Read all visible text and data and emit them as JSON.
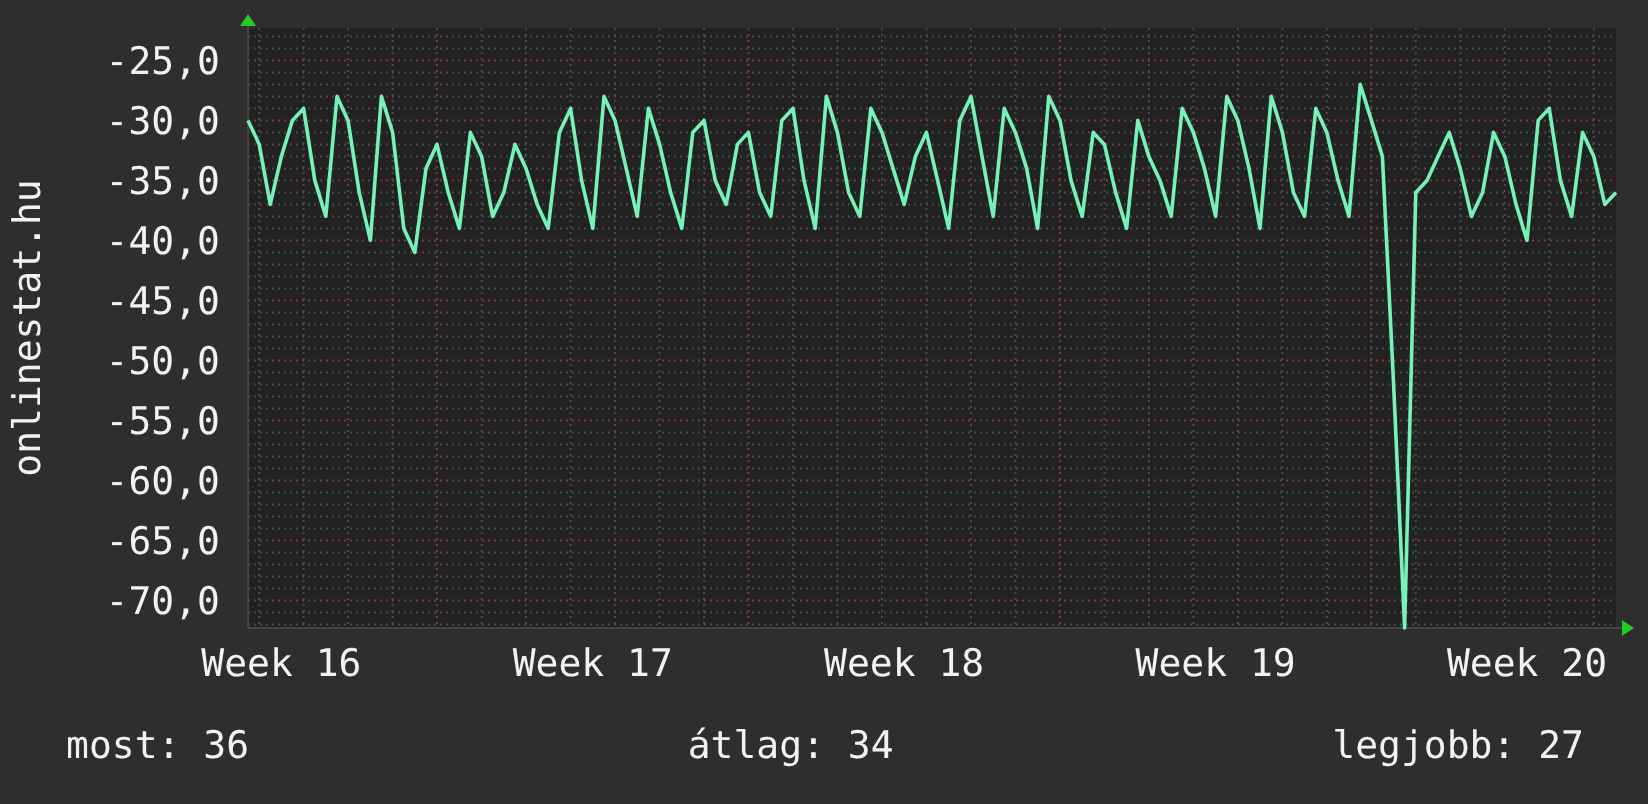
{
  "chart": {
    "chart_data": {
      "type": "line",
      "ylabel": "onlinestat.hu",
      "grid": true,
      "ylim": [
        -72.3,
        -22.3
      ],
      "categories": [
        null,
        null,
        null,
        "Week 16",
        null,
        null,
        null,
        null,
        null,
        null,
        null,
        null,
        null,
        null,
        null,
        null,
        null,
        null,
        null,
        null,
        null,
        null,
        null,
        null,
        null,
        null,
        null,
        null,
        null,
        null,
        null,
        "Week 17",
        null,
        null,
        null,
        null,
        null,
        null,
        null,
        null,
        null,
        null,
        null,
        null,
        null,
        null,
        null,
        null,
        null,
        null,
        null,
        null,
        null,
        null,
        null,
        null,
        null,
        null,
        null,
        "Week 18",
        null,
        null,
        null,
        null,
        null,
        null,
        null,
        null,
        null,
        null,
        null,
        null,
        null,
        null,
        null,
        null,
        null,
        null,
        null,
        null,
        null,
        null,
        null,
        null,
        null,
        null,
        null,
        "Week 19",
        null,
        null,
        null,
        null,
        null,
        null,
        null,
        null,
        null,
        null,
        null,
        null,
        null,
        null,
        null,
        null,
        null,
        null,
        null,
        null,
        null,
        null,
        null,
        null,
        null,
        null,
        null,
        "Week 20",
        null,
        null,
        null,
        null,
        null,
        null,
        null,
        null
      ],
      "yticks": [
        {
          "value": -25,
          "label": "-25,0"
        },
        {
          "value": -30,
          "label": "-30,0"
        },
        {
          "value": -35,
          "label": "-35,0"
        },
        {
          "value": -40,
          "label": "-40,0"
        },
        {
          "value": -45,
          "label": "-45,0"
        },
        {
          "value": -50,
          "label": "-50,0"
        },
        {
          "value": -55,
          "label": "-55,0"
        },
        {
          "value": -60,
          "label": "-60,0"
        },
        {
          "value": -65,
          "label": "-65,0"
        },
        {
          "value": -70,
          "label": "-70,0"
        }
      ],
      "series": [
        {
          "color": "#77f2b6",
          "values": [
            -30,
            -32,
            -37,
            -33,
            -30,
            -29,
            -35,
            -38,
            -28,
            -30,
            -36,
            -40,
            -28,
            -31,
            -39,
            -41,
            -34,
            -32,
            -36,
            -39,
            -31,
            -33,
            -38,
            -36,
            -32,
            -34,
            -37,
            -39,
            -31,
            -29,
            -35,
            -39,
            -28,
            -30,
            -34,
            -38,
            -29,
            -32,
            -36,
            -39,
            -31,
            -30,
            -35,
            -37,
            -32,
            -31,
            -36,
            -38,
            -30,
            -29,
            -35,
            -39,
            -28,
            -31,
            -36,
            -38,
            -29,
            -31,
            -34,
            -37,
            -33,
            -31,
            -35,
            -39,
            -30,
            -28,
            -33,
            -38,
            -29,
            -31,
            -34,
            -39,
            -28,
            -30,
            -35,
            -38,
            -31,
            -32,
            -36,
            -39,
            -30,
            -33,
            -35,
            -38,
            -29,
            -31,
            -34,
            -38,
            -28,
            -30,
            -34,
            -39,
            -28,
            -31,
            -36,
            -38,
            -29,
            -31,
            -35,
            -38,
            -27,
            -30,
            -33,
            -52,
            -72.3,
            -36,
            -35,
            -33,
            -31,
            -34,
            -38,
            -36,
            -31,
            -33,
            -37,
            -40,
            -30,
            -29,
            -35,
            -38,
            -31,
            -33,
            -37,
            -36
          ]
        }
      ]
    }
  },
  "legend": [
    {
      "label": "most: 36"
    },
    {
      "label": "átlag: 34"
    },
    {
      "label": "legjobb: 27"
    }
  ]
}
